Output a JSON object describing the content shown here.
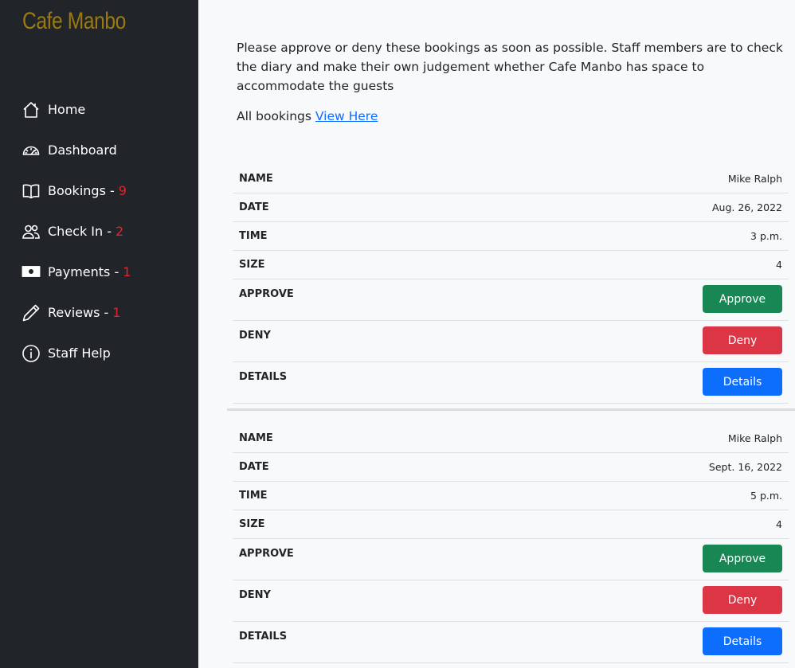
{
  "brand": "Cafe Manbo",
  "nav": [
    {
      "label": "Home",
      "count": "",
      "icon": "home-icon"
    },
    {
      "label": "Dashboard",
      "count": "",
      "icon": "speedometer-icon"
    },
    {
      "label": "Bookings - ",
      "count": "9",
      "icon": "book-icon"
    },
    {
      "label": "Check In - ",
      "count": "2",
      "icon": "people-icon"
    },
    {
      "label": "Payments - ",
      "count": "1",
      "icon": "cash-icon"
    },
    {
      "label": "Reviews - ",
      "count": "1",
      "icon": "pencil-icon"
    },
    {
      "label": "Staff Help",
      "count": "",
      "icon": "info-icon"
    }
  ],
  "intro": "Please approve or deny these bookings as soon as possible. Staff members are to check the diary and make their own judgement whether Cafe Manbo has space to accommodate the guests",
  "all_bookings": {
    "text": "All bookings ",
    "link": "View Here"
  },
  "labels": {
    "name": "NAME",
    "date": "DATE",
    "time": "TIME",
    "size": "SIZE",
    "approve": "APPROVE",
    "deny": "DENY",
    "details": "DETAILS",
    "approve_btn": "Approve",
    "deny_btn": "Deny",
    "details_btn": "Details"
  },
  "bookings": [
    {
      "name": "Mike Ralph",
      "date": "Aug. 26, 2022",
      "time": "3 p.m.",
      "size": "4"
    },
    {
      "name": "Mike Ralph",
      "date": "Sept. 16, 2022",
      "time": "5 p.m.",
      "size": "4"
    }
  ],
  "colors": {
    "sidebar_bg": "#212529",
    "brand": "#9c7a0e",
    "count": "#e3252b",
    "approve": "#198754",
    "deny": "#dc3545",
    "details": "#0d6efd"
  }
}
